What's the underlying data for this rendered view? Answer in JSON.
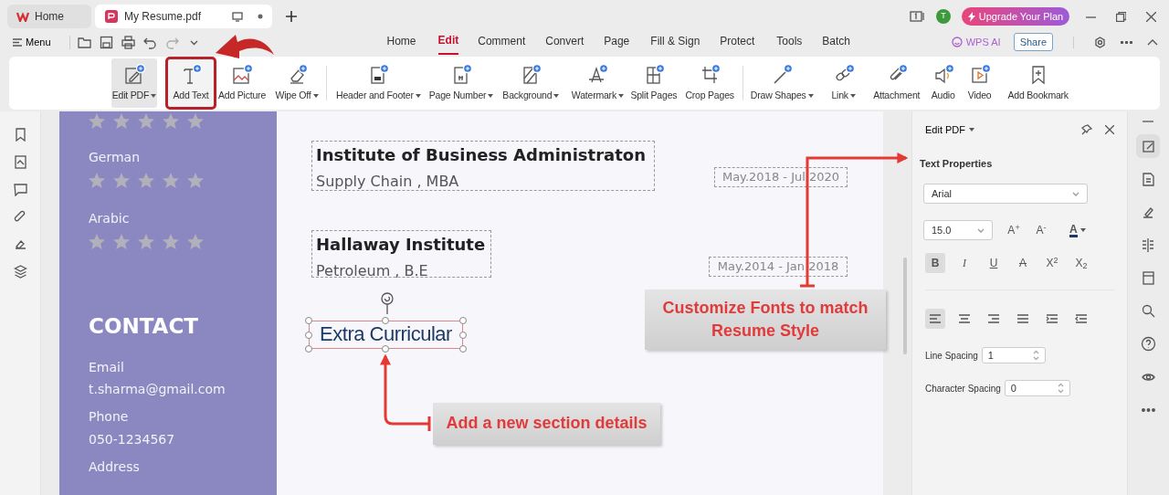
{
  "tabs": [
    {
      "label": "Home",
      "selected": false
    },
    {
      "label": "My Resume.pdf",
      "selected": true
    }
  ],
  "menu": "Menu",
  "nav": [
    {
      "label": "Home",
      "selected": false
    },
    {
      "label": "Edit",
      "selected": true
    },
    {
      "label": "Comment",
      "selected": false
    },
    {
      "label": "Convert",
      "selected": false
    },
    {
      "label": "Page",
      "selected": false
    },
    {
      "label": "Fill & Sign",
      "selected": false
    },
    {
      "label": "Protect",
      "selected": false
    },
    {
      "label": "Tools",
      "selected": false
    },
    {
      "label": "Batch",
      "selected": false
    }
  ],
  "account": {
    "initial": "T",
    "upgrade": "Upgrade Your Plan",
    "ai": "WPS AI",
    "share": "Share"
  },
  "ribbon": [
    {
      "items": [
        {
          "label": "Edit PDF",
          "dropdown": true,
          "selected": true,
          "outlined": false
        },
        {
          "label": "Add Text",
          "dropdown": false,
          "selected": false,
          "outlined": true
        },
        {
          "label": "Add Picture",
          "dropdown": false,
          "selected": false,
          "outlined": false
        },
        {
          "label": "Wipe Off",
          "dropdown": true,
          "selected": false,
          "outlined": false
        }
      ]
    },
    {
      "items": [
        {
          "label": "Header and Footer",
          "dropdown": true,
          "selected": false,
          "outlined": false
        },
        {
          "label": "Page Number",
          "dropdown": true,
          "selected": false,
          "outlined": false
        },
        {
          "label": "Background",
          "dropdown": true,
          "selected": false,
          "outlined": false
        },
        {
          "label": "Watermark",
          "dropdown": true,
          "selected": false,
          "outlined": false
        },
        {
          "label": "Split Pages",
          "dropdown": false,
          "selected": false,
          "outlined": false
        },
        {
          "label": "Crop Pages",
          "dropdown": false,
          "selected": false,
          "outlined": false
        }
      ]
    },
    {
      "items": [
        {
          "label": "Draw Shapes",
          "dropdown": true,
          "selected": false,
          "outlined": false
        },
        {
          "label": "Link",
          "dropdown": true,
          "selected": false,
          "outlined": false
        },
        {
          "label": "Attachment",
          "dropdown": false,
          "selected": false,
          "outlined": false
        },
        {
          "label": "Audio",
          "dropdown": false,
          "selected": false,
          "outlined": false
        },
        {
          "label": "Video",
          "dropdown": false,
          "selected": false,
          "outlined": false
        },
        {
          "label": "Add Bookmark",
          "dropdown": false,
          "selected": false,
          "outlined": false
        }
      ]
    }
  ],
  "document": {
    "languages": [
      {
        "stars": 0
      },
      {
        "name": "German",
        "stars": 0
      },
      {
        "name": "Arabic",
        "stars": 0
      }
    ],
    "contact_heading": "CONTACT",
    "contact": [
      {
        "label": "Email",
        "value": "t.sharma@gmail.com"
      },
      {
        "label": "Phone",
        "value": "050-1234567"
      },
      {
        "label": "Address"
      }
    ],
    "education": [
      {
        "institution": "Institute of Business Administraton",
        "degree": "Supply Chain , MBA",
        "dates": "May.2018 - Jul 2020"
      },
      {
        "institution": "Hallaway Institute",
        "degree": "Petroleum , B.E",
        "dates": "May.2014 - Jan 2018"
      }
    ],
    "new_text": "Extra Curricular"
  },
  "callouts": [
    "Customize Fonts to match Resume Style",
    "Add a new section details"
  ],
  "panel": {
    "title": "Edit PDF",
    "section": "Text Properties",
    "font": "Arial",
    "size": "15.0",
    "size_buttons": [
      "A$^{+}$",
      "A$^{-}$"
    ],
    "font_color": "A",
    "styles": [
      {
        "label": "B",
        "selected": true
      },
      {
        "label": "I",
        "selected": false
      },
      {
        "label": "U",
        "selected": false
      },
      {
        "label": "A",
        "selected": false
      },
      {
        "label": "X$^{2}$",
        "selected": false
      },
      {
        "label": "X$_{2}$",
        "selected": false
      }
    ],
    "alignments": [
      {
        "selected": true
      },
      {
        "selected": false
      },
      {
        "selected": false
      },
      {
        "selected": false
      },
      {
        "selected": false
      },
      {
        "selected": false
      }
    ],
    "line_spacing": {
      "label": "Line Spacing",
      "value": "1"
    },
    "character_spacing": {
      "label": "Character Spacing",
      "value": "0"
    }
  }
}
